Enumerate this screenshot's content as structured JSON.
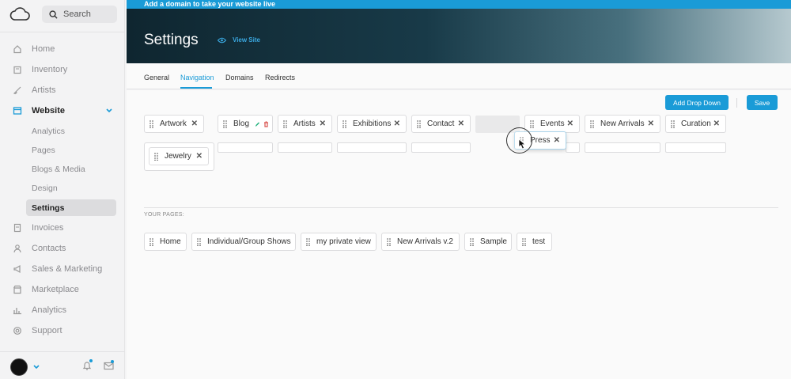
{
  "sidebar": {
    "search_placeholder": "Search",
    "items": [
      {
        "label": "Home",
        "icon": "home-icon"
      },
      {
        "label": "Inventory",
        "icon": "inventory-icon"
      },
      {
        "label": "Artists",
        "icon": "brush-icon"
      },
      {
        "label": "Website",
        "icon": "website-icon"
      },
      {
        "label": "Invoices",
        "icon": "invoice-icon"
      },
      {
        "label": "Contacts",
        "icon": "contacts-icon"
      },
      {
        "label": "Sales & Marketing",
        "icon": "megaphone-icon"
      },
      {
        "label": "Marketplace",
        "icon": "store-icon"
      },
      {
        "label": "Analytics",
        "icon": "analytics-icon"
      },
      {
        "label": "Support",
        "icon": "support-icon"
      }
    ],
    "website_subitems": [
      "Analytics",
      "Pages",
      "Blogs & Media",
      "Design",
      "Settings"
    ]
  },
  "banner": {
    "text": "Add a domain to take your website live"
  },
  "header": {
    "title": "Settings",
    "view_site": "View Site"
  },
  "tabs": [
    "General",
    "Navigation",
    "Domains",
    "Redirects"
  ],
  "active_tab": "Navigation",
  "actions": {
    "add_dropdown": "Add Drop Down",
    "save": "Save"
  },
  "nav_items": [
    "Artwork",
    "Blog",
    "Artists",
    "Exhibitions",
    "Contact",
    "Events",
    "New Arrivals",
    "Curation"
  ],
  "nav_row2": [
    "Jewelry"
  ],
  "dragging_item": "Press",
  "your_pages": {
    "label": "YOUR PAGES:",
    "items": [
      "Home",
      "Individual/Group Shows",
      "my private view",
      "New Arrivals v.2",
      "Sample",
      "test"
    ]
  },
  "colors": {
    "accent": "#1a9bd7",
    "header_dark": "#0f2630",
    "delete_red": "#d9534f",
    "edit_green": "#1bb07a"
  }
}
